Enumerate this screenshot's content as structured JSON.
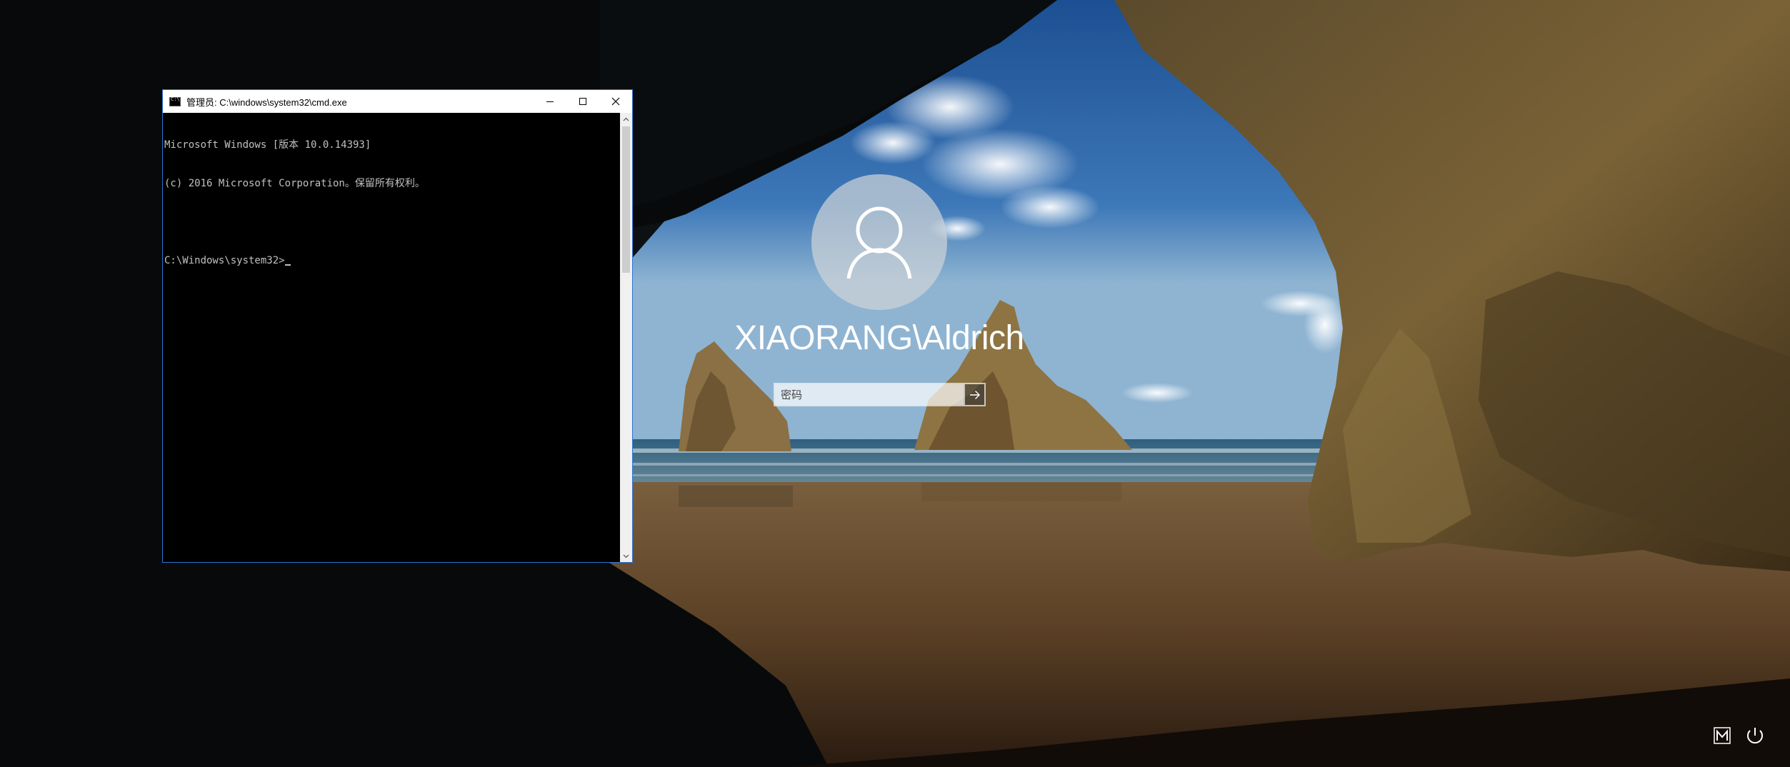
{
  "cmd_window": {
    "title": "管理员: C:\\windows\\system32\\cmd.exe",
    "lines": [
      "Microsoft Windows [版本 10.0.14393]",
      "(c) 2016 Microsoft Corporation。保留所有权利。",
      "",
      "C:\\Windows\\system32>"
    ]
  },
  "login": {
    "username": "XIAORANG\\Aldrich",
    "password_placeholder": "密码"
  },
  "icons": {
    "cmd_icon": "console-icon",
    "minimize": "minimize-icon",
    "maximize": "maximize-icon",
    "close": "close-icon",
    "avatar": "user-icon",
    "submit": "arrow-right-icon",
    "ease_of_access": "ease-of-access-icon",
    "power": "power-icon"
  },
  "colors": {
    "cmd_border": "#2b73d6",
    "console_text": "#c0c0c0",
    "console_bg": "#000000"
  }
}
